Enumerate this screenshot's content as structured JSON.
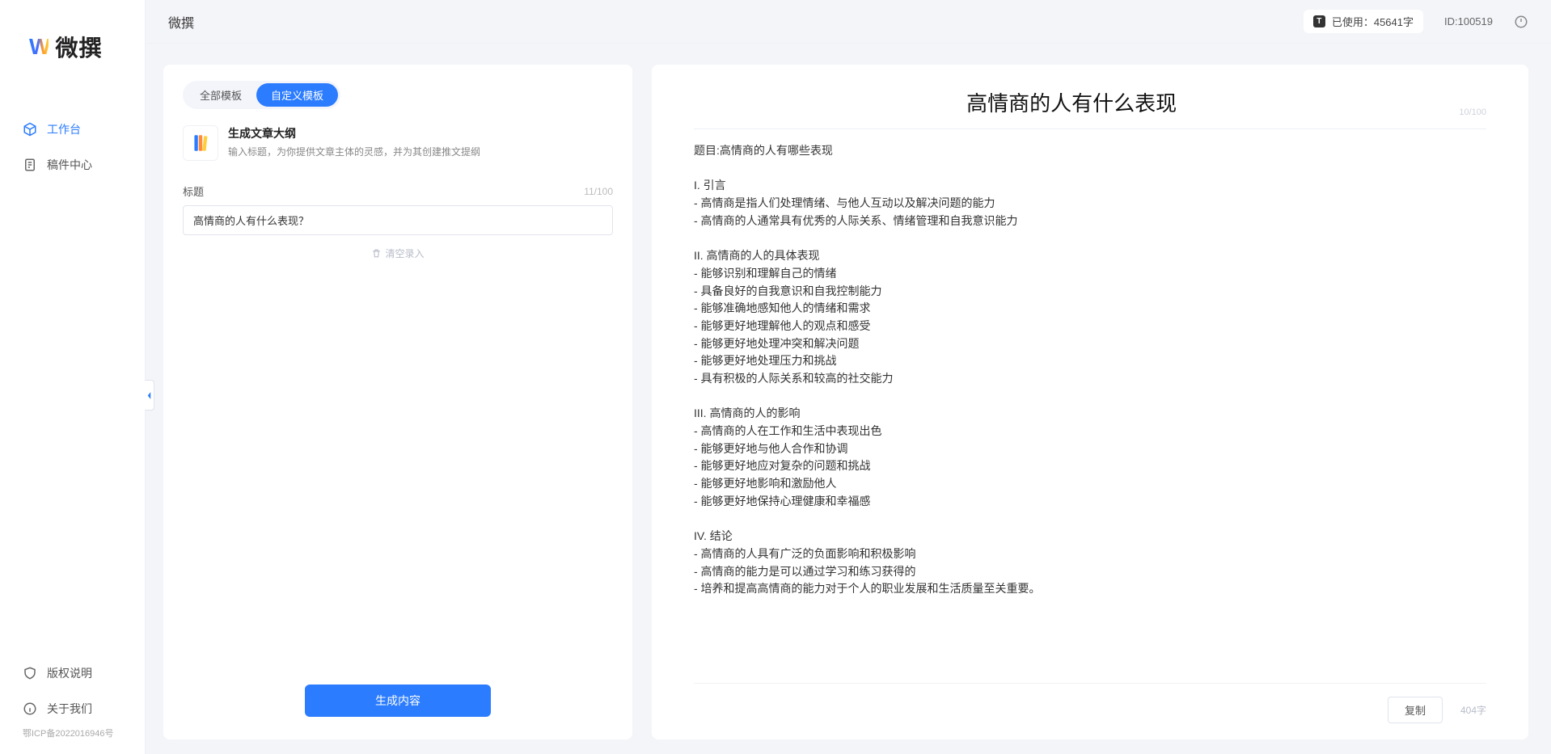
{
  "brand": {
    "mark": "W",
    "name": "微撰"
  },
  "nav": {
    "items": [
      {
        "label": "工作台",
        "active": true,
        "name": "nav-workspace"
      },
      {
        "label": "稿件中心",
        "active": false,
        "name": "nav-drafts"
      }
    ],
    "bottom": [
      {
        "label": "版权说明",
        "name": "nav-copyright"
      },
      {
        "label": "关于我们",
        "name": "nav-about"
      }
    ],
    "icp": "鄂ICP备2022016946号"
  },
  "topbar": {
    "title": "微撰",
    "usage": "已使用：45641字",
    "id": "ID:100519"
  },
  "left": {
    "tabs": [
      {
        "label": "全部模板",
        "active": false
      },
      {
        "label": "自定义模板",
        "active": true
      }
    ],
    "template": {
      "title": "生成文章大纲",
      "desc": "输入标题，为你提供文章主体的灵感，并为其创建推文提纲"
    },
    "field": {
      "label": "标题",
      "value": "高情商的人有什么表现？",
      "count": "11/100"
    },
    "clear": "清空录入",
    "generate": "生成内容"
  },
  "right": {
    "title": "高情商的人有什么表现",
    "title_count": "10/100",
    "body": "题目:高情商的人有哪些表现\n\nI. 引言\n- 高情商是指人们处理情绪、与他人互动以及解决问题的能力\n- 高情商的人通常具有优秀的人际关系、情绪管理和自我意识能力\n\nII. 高情商的人的具体表现\n- 能够识别和理解自己的情绪\n- 具备良好的自我意识和自我控制能力\n- 能够准确地感知他人的情绪和需求\n- 能够更好地理解他人的观点和感受\n- 能够更好地处理冲突和解决问题\n- 能够更好地处理压力和挑战\n- 具有积极的人际关系和较高的社交能力\n\nIII. 高情商的人的影响\n- 高情商的人在工作和生活中表现出色\n- 能够更好地与他人合作和协调\n- 能够更好地应对复杂的问题和挑战\n- 能够更好地影响和激励他人\n- 能够更好地保持心理健康和幸福感\n\nIV. 结论\n- 高情商的人具有广泛的负面影响和积极影响\n- 高情商的能力是可以通过学习和练习获得的\n- 培养和提高高情商的能力对于个人的职业发展和生活质量至关重要。",
    "copy": "复制",
    "wordcount": "404字"
  }
}
